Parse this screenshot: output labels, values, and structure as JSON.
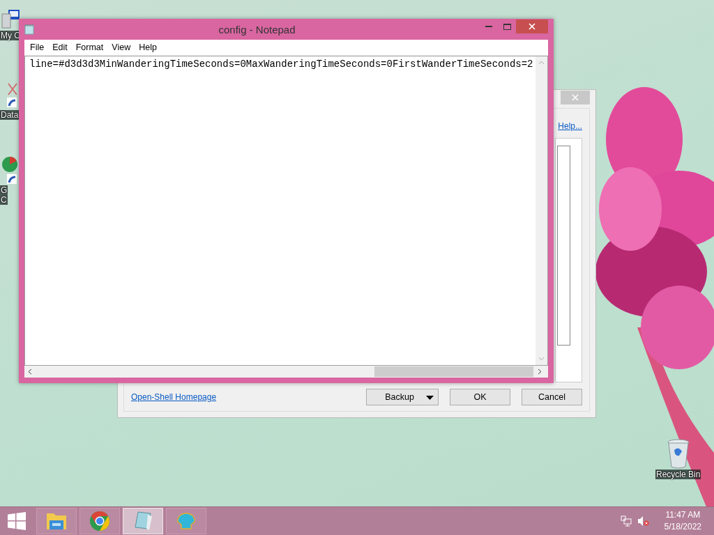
{
  "desktop_icons": [
    {
      "kind": "computer",
      "label_lines": [
        "My C"
      ]
    },
    {
      "kind": "database",
      "label_lines": [
        "Data"
      ]
    },
    {
      "kind": "chrome",
      "label_lines": [
        "G",
        "C"
      ]
    },
    {
      "kind": "recycle-bin",
      "label_lines": [
        "Recycle Bin"
      ]
    }
  ],
  "settings_dialog": {
    "help_link": "Help...",
    "homepage_link": "Open-Shell Homepage",
    "buttons": [
      {
        "label": "Backup",
        "kind": "split"
      },
      {
        "label": "OK",
        "kind": "plain"
      },
      {
        "label": "Cancel",
        "kind": "plain"
      }
    ]
  },
  "notepad": {
    "title": "config - Notepad",
    "menu": [
      "File",
      "Edit",
      "Format",
      "View",
      "Help"
    ],
    "text": "line=#d3d3d3MinWanderingTimeSeconds=0MaxWanderingTimeSeconds=0FirstWanderTimeSeconds=2"
  },
  "taskbar": {
    "apps": [
      {
        "kind": "explorer",
        "selected": false
      },
      {
        "kind": "chrome",
        "selected": false
      },
      {
        "kind": "notepad",
        "selected": true
      },
      {
        "kind": "shell",
        "selected": false
      }
    ],
    "time": "11:47 AM",
    "date": "5/18/2022"
  }
}
